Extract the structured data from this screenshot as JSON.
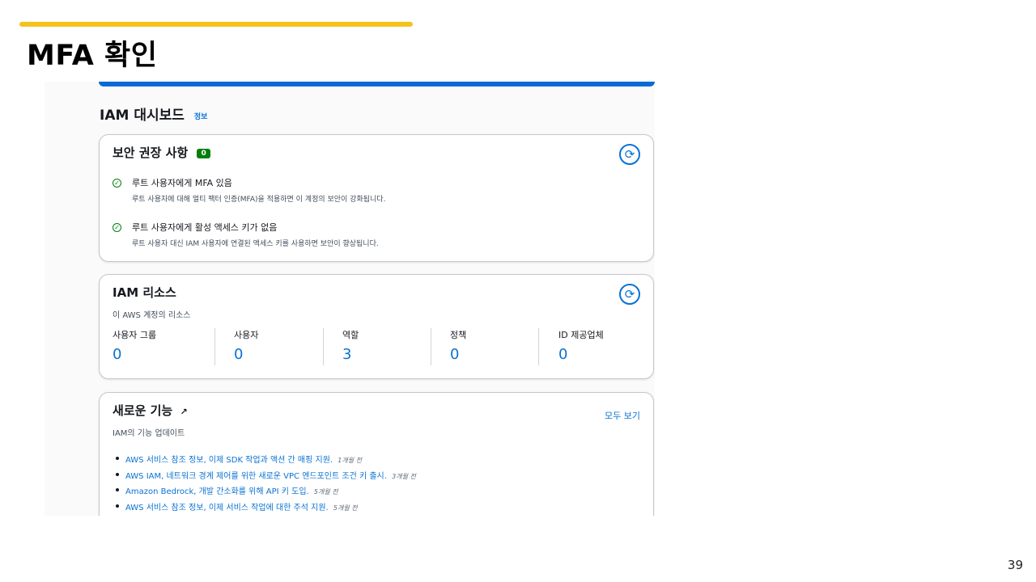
{
  "slide": {
    "title": "MFA 확인",
    "page_number": "39"
  },
  "dashboard": {
    "title": "IAM 대시보드",
    "info_link": "정보"
  },
  "security": {
    "title": "보안 권장 사항",
    "badge": "0",
    "items": [
      {
        "title": "루트 사용자에게 MFA 있음",
        "description": "루트 사용자에 대해 멀티 팩터 인증(MFA)을 적용하면 이 계정의 보안이 강화됩니다."
      },
      {
        "title": "루트 사용자에게 활성 액세스 키가 없음",
        "description": "루트 사용자 대신 IAM 사용자에 연결된 액세스 키를 사용하면 보안이 향상됩니다."
      }
    ]
  },
  "resources": {
    "title": "IAM 리소스",
    "subtitle": "이 AWS 계정의 리소스",
    "metrics": [
      {
        "label": "사용자 그룹",
        "value": "0"
      },
      {
        "label": "사용자",
        "value": "0"
      },
      {
        "label": "역할",
        "value": "3"
      },
      {
        "label": "정책",
        "value": "0"
      },
      {
        "label": "ID 제공업체",
        "value": "0"
      }
    ]
  },
  "whats_new": {
    "title": "새로운 기능",
    "subtitle": "IAM의 기능 업데이트",
    "view_all": "모두 보기",
    "items": [
      {
        "text": "AWS 서비스 참조 정보, 이제 SDK 작업과 액션 간 매핑 지원.",
        "time": "1개월 전"
      },
      {
        "text": "AWS IAM, 네트워크 경계 제어를 위한 새로운 VPC 엔드포인트 조건 키 출시.",
        "time": "3개월 전"
      },
      {
        "text": "Amazon Bedrock, 개발 간소화를 위해 API 키 도입.",
        "time": "5개월 전"
      },
      {
        "text": "AWS 서비스 참조 정보, 이제 서비스 작업에 대한 주석 지원.",
        "time": "5개월 전"
      }
    ]
  },
  "colors": {
    "slide_bar": "#f5c21b",
    "link": "#0972d3",
    "success": "#037f0c",
    "top_bar": "#0a6bd6"
  }
}
